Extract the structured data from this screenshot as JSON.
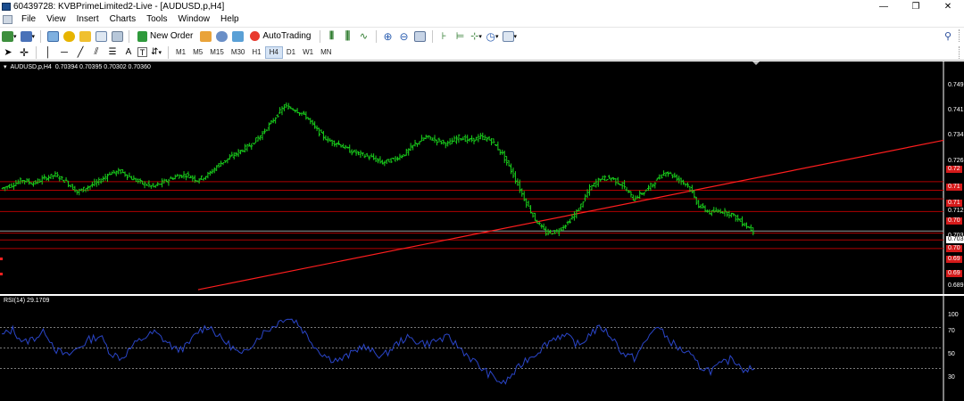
{
  "window": {
    "title": "60439728: KVBPrimeLimited2-Live - [AUDUSD,p,H4]",
    "minimize": "—",
    "maximize": "❐",
    "close": "✕"
  },
  "menu": {
    "items": [
      "File",
      "View",
      "Insert",
      "Charts",
      "Tools",
      "Window",
      "Help"
    ],
    "mdi_buttons": [
      "–",
      "❐",
      "✕"
    ]
  },
  "toolbar1": {
    "new_order": "New Order",
    "autotrading": "AutoTrading"
  },
  "toolbar2": {
    "timeframes": [
      "M1",
      "M5",
      "M15",
      "M30",
      "H1",
      "H4",
      "D1",
      "W1",
      "MN"
    ],
    "active_timeframe": "H4"
  },
  "chart": {
    "symbol_info": "AUDUSD,p,H4",
    "ohlc": "0.70394 0.70395 0.70302 0.70360",
    "bull_color": "#19d01c",
    "trendline_color": "#ff1e1e",
    "level_line_color": "#b00000",
    "price_labels": [
      "0.749",
      "0.741",
      "0.734",
      "0.726",
      "0.712",
      "0.703",
      "0.689"
    ],
    "level_labels": [
      "0.72",
      "0.71",
      "0.71",
      "0.70",
      "0.70",
      "0.69",
      "0.69"
    ],
    "current_price_label": "0.703",
    "rsi_label": "RSI(14) 29.1709",
    "rsi_levels": [
      "100",
      "70",
      "50",
      "30"
    ],
    "rsi_color": "#2a45c8"
  },
  "chart_data": {
    "type": "line",
    "title": "AUDUSD,p,H4",
    "series": [
      {
        "name": "AUDUSD,p",
        "values": [
          0.716,
          0.717,
          0.7185,
          0.7175,
          0.719,
          0.72,
          0.718,
          0.715,
          0.7165,
          0.718,
          0.7205,
          0.721,
          0.719,
          0.7175,
          0.7165,
          0.718,
          0.7195,
          0.72,
          0.7185,
          0.72,
          0.723,
          0.725,
          0.727,
          0.729,
          0.732,
          0.736,
          0.74,
          0.739,
          0.737,
          0.733,
          0.73,
          0.729,
          0.727,
          0.726,
          0.725,
          0.7235,
          0.7245,
          0.726,
          0.729,
          0.731,
          0.73,
          0.729,
          0.731,
          0.73,
          0.731,
          0.73,
          0.726,
          0.72,
          0.713,
          0.707,
          0.703,
          0.7035,
          0.706,
          0.71,
          0.716,
          0.719,
          0.719,
          0.717,
          0.713,
          0.715,
          0.718,
          0.721,
          0.719,
          0.717,
          0.711,
          0.709,
          0.7095,
          0.7085,
          0.706,
          0.7036
        ]
      },
      {
        "name": "RSI(14)",
        "values": [
          62,
          68,
          55,
          60,
          66,
          48,
          42,
          50,
          58,
          62,
          45,
          40,
          52,
          60,
          65,
          57,
          48,
          52,
          66,
          72,
          60,
          52,
          42,
          55,
          65,
          72,
          80,
          76,
          62,
          48,
          40,
          38,
          44,
          52,
          46,
          42,
          52,
          60,
          57,
          54,
          58,
          60,
          50,
          40,
          30,
          22,
          15,
          26,
          38,
          45,
          55,
          62,
          60,
          52,
          65,
          70,
          60,
          44,
          40,
          55,
          72,
          60,
          50,
          44,
          32,
          28,
          34,
          40,
          30,
          29.17
        ]
      }
    ],
    "ylim": [
      0.686,
      0.752
    ],
    "rsi_ylim": [
      0,
      100
    ],
    "levels": [
      0.718,
      0.7155,
      0.713,
      0.7093,
      0.703,
      0.701,
      0.6985
    ],
    "trendline": [
      [
        18,
        0.6865
      ],
      [
        69,
        0.719
      ]
    ]
  }
}
